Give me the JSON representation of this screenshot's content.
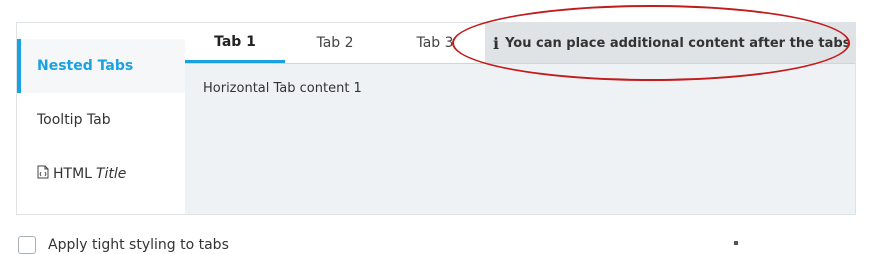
{
  "vertical_tabs": [
    {
      "label": "Nested Tabs",
      "active": true
    },
    {
      "label": "Tooltip Tab",
      "active": false
    },
    {
      "label": "HTML",
      "italic_suffix": "Title",
      "icon": "document-icon",
      "active": false
    }
  ],
  "horizontal_tabs": [
    {
      "label": "Tab 1",
      "active": true
    },
    {
      "label": "Tab 2",
      "active": false
    },
    {
      "label": "Tab 3",
      "active": false
    }
  ],
  "tab_extra": {
    "icon": "info-icon",
    "text": "You can place additional content after the tabs"
  },
  "tab_content": "Horizontal Tab content 1",
  "options": {
    "tight_styling_label": "Apply tight styling to tabs"
  },
  "colors": {
    "accent": "#1aa1e0",
    "annotation": "#c11b1b",
    "panel_bg": "#eff2f5",
    "extra_bg": "#e0e3e6"
  }
}
